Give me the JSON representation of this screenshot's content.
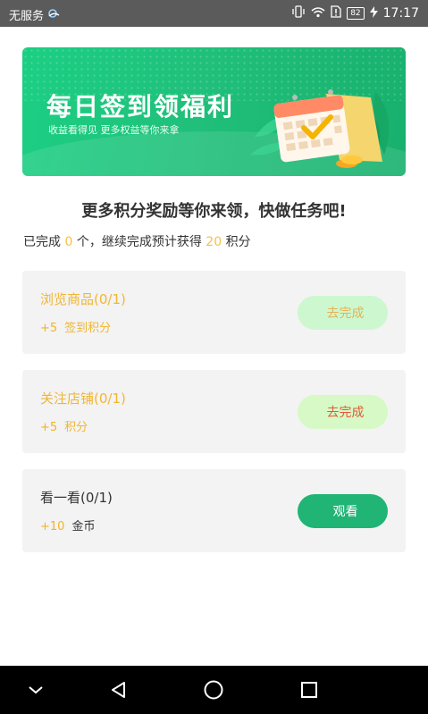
{
  "status_bar": {
    "carrier": "无服务",
    "battery": "82",
    "time": "17:17"
  },
  "banner": {
    "title": "每日签到领福利",
    "subtitle": "收益看得见 更多权益等你来拿"
  },
  "heading": "更多积分奖励等你来领，快做任务吧!",
  "progress": {
    "prefix": "已完成",
    "completed": "0",
    "middle": "个，继续完成预计获得",
    "expected": "20",
    "suffix": "积分"
  },
  "tasks": [
    {
      "name": "浏览商品(0/1)",
      "points": "+5",
      "reward_label": "签到积分",
      "button": "去完成"
    },
    {
      "name": "关注店铺(0/1)",
      "points": "+5",
      "reward_label": "积分",
      "button": "去完成"
    },
    {
      "name": "看一看(0/1)",
      "points": "+10",
      "reward_label": "金币",
      "button": "观看"
    }
  ],
  "nav": {
    "icons": [
      "chevron-down-icon",
      "back-icon",
      "home-icon",
      "recents-icon"
    ]
  },
  "colors": {
    "banner_green": "#1bcf83",
    "accent_yellow": "#f5c242",
    "watch_button": "#20b475",
    "task_card_bg": "#f3f3f3"
  }
}
